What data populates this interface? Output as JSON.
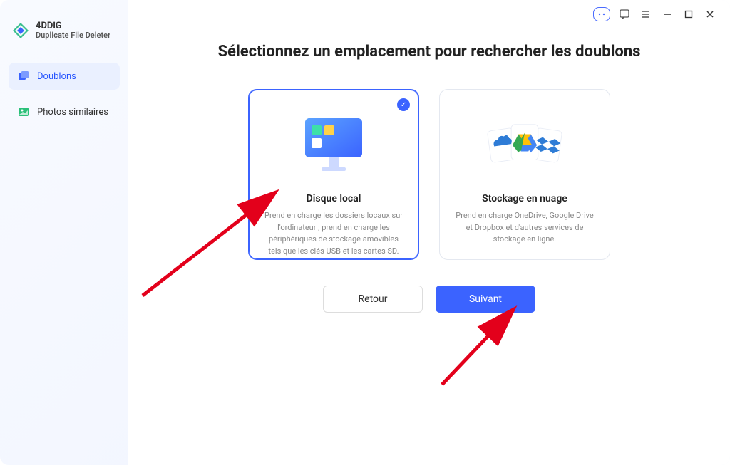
{
  "app": {
    "name": "4DDiG",
    "subtitle": "Duplicate File Deleter"
  },
  "sidebar": {
    "items": [
      {
        "label": "Doublons"
      },
      {
        "label": "Photos similaires"
      }
    ]
  },
  "main": {
    "title": "Sélectionnez un emplacement pour rechercher les doublons",
    "cards": [
      {
        "title": "Disque local",
        "desc": "Prend en charge les dossiers locaux sur l'ordinateur ; prend en charge les périphériques de stockage amovibles tels que les clés USB et les cartes SD."
      },
      {
        "title": "Stockage en nuage",
        "desc": "Prend en charge OneDrive, Google Drive et Dropbox et d'autres services de stockage en ligne."
      }
    ],
    "buttons": {
      "back": "Retour",
      "next": "Suivant"
    }
  }
}
